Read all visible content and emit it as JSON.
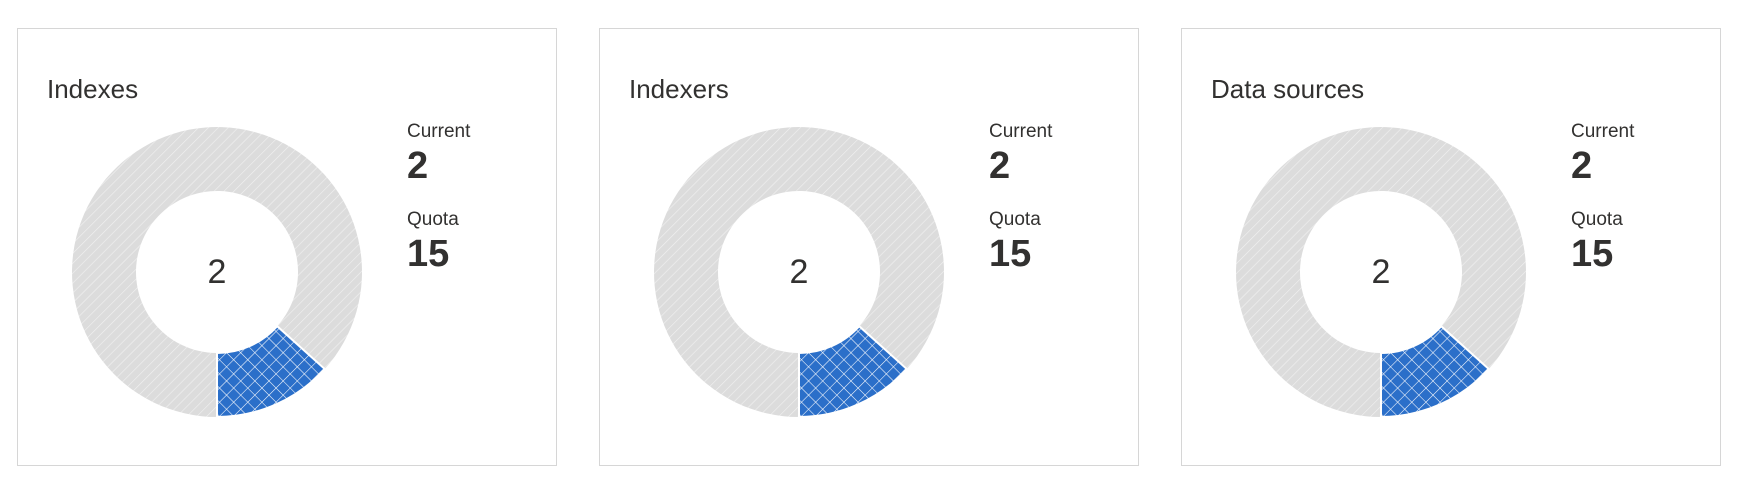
{
  "colors": {
    "used": "#2b6fc9",
    "remaining": "#dcdcdc",
    "border": "#d6d6d6",
    "text": "#323130"
  },
  "cards": [
    {
      "title": "Indexes",
      "center_value": "2",
      "current_label": "Current",
      "current_value": "2",
      "quota_label": "Quota",
      "quota_value": "15",
      "used": 2,
      "quota": 15
    },
    {
      "title": "Indexers",
      "center_value": "2",
      "current_label": "Current",
      "current_value": "2",
      "quota_label": "Quota",
      "quota_value": "15",
      "used": 2,
      "quota": 15
    },
    {
      "title": "Data sources",
      "center_value": "2",
      "current_label": "Current",
      "current_value": "2",
      "quota_label": "Quota",
      "quota_value": "15",
      "used": 2,
      "quota": 15
    }
  ]
}
